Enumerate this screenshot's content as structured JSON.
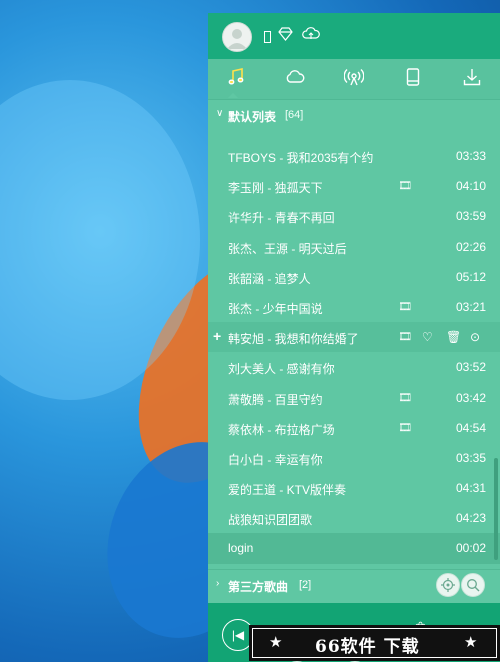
{
  "desktop": {
    "background": "#1e84d2"
  },
  "header": {
    "username": "",
    "vip_icon": "diamond-icon",
    "cloud_icon": "cloud-sync-icon"
  },
  "tabs": [
    {
      "icon": "music-note-icon",
      "active": true
    },
    {
      "icon": "cloud-icon",
      "active": false
    },
    {
      "icon": "radio-icon",
      "active": false
    },
    {
      "icon": "phone-device-icon",
      "active": false
    },
    {
      "icon": "download-icon",
      "active": false
    }
  ],
  "playlist": {
    "title": "默认列表",
    "count": "[64]",
    "items": [
      {
        "title": "TFBOYS - 我和2035有个约",
        "duration": "03:33",
        "mv": false
      },
      {
        "title": "李玉刚 - 独孤天下",
        "duration": "04:10",
        "mv": true
      },
      {
        "title": "许华升 - 青春不再回",
        "duration": "03:59",
        "mv": false
      },
      {
        "title": "张杰、王源 - 明天过后",
        "duration": "02:26",
        "mv": false
      },
      {
        "title": "张韶涵 - 追梦人",
        "duration": "05:12",
        "mv": false
      },
      {
        "title": "张杰 - 少年中国说",
        "duration": "03:21",
        "mv": true
      },
      {
        "title": "韩安旭 - 我想和你结婚了",
        "duration": "",
        "mv": true,
        "hover": true
      },
      {
        "title": "刘大美人 - 感谢有你",
        "duration": "03:52",
        "mv": false
      },
      {
        "title": "萧敬腾 - 百里守约",
        "duration": "03:42",
        "mv": true
      },
      {
        "title": "蔡依林 - 布拉格广场",
        "duration": "04:54",
        "mv": true
      },
      {
        "title": "白小白 - 幸运有你",
        "duration": "03:35",
        "mv": false
      },
      {
        "title": "爱的王道 - KTV版伴奏",
        "duration": "04:31",
        "mv": false
      },
      {
        "title": "战狼知识团团歌",
        "duration": "04:23",
        "mv": false
      },
      {
        "title": "login",
        "duration": "00:02",
        "mv": false
      }
    ]
  },
  "third_party": {
    "label": "第三方歌曲",
    "count": "[2]"
  },
  "watermark": {
    "star_left": "★",
    "text": "66软件 下载",
    "star_right": "★"
  },
  "colors": {
    "accent": "#1aab7d",
    "list_bg": "#5fc7a3"
  }
}
